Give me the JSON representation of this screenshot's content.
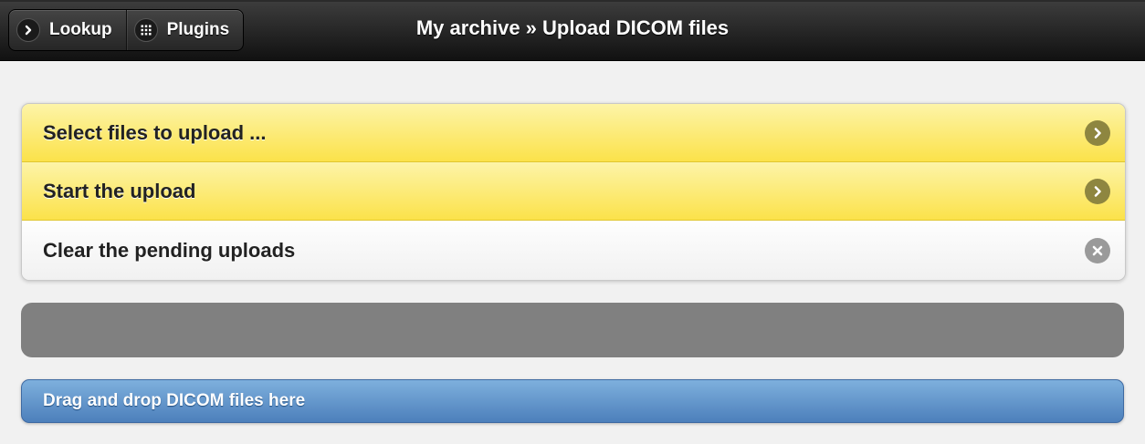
{
  "header": {
    "title": "My archive » Upload DICOM files",
    "buttons": [
      {
        "label": "Lookup",
        "icon": "chevron-right-icon"
      },
      {
        "label": "Plugins",
        "icon": "grid-icon"
      }
    ]
  },
  "actions": [
    {
      "label": "Select files to upload ...",
      "icon": "chevron-right-icon",
      "style": "yellow"
    },
    {
      "label": "Start the upload",
      "icon": "chevron-right-icon",
      "style": "yellow"
    },
    {
      "label": "Clear the pending uploads",
      "icon": "close-icon",
      "style": "plain"
    }
  ],
  "progress": {
    "value": 0,
    "bar_color": "#808080"
  },
  "dropzone": {
    "label": "Drag and drop DICOM files here"
  },
  "colors": {
    "header": "#1e1e1e",
    "action_yellow": "#fbe24a",
    "dropzone_blue": "#5b8dc6"
  }
}
